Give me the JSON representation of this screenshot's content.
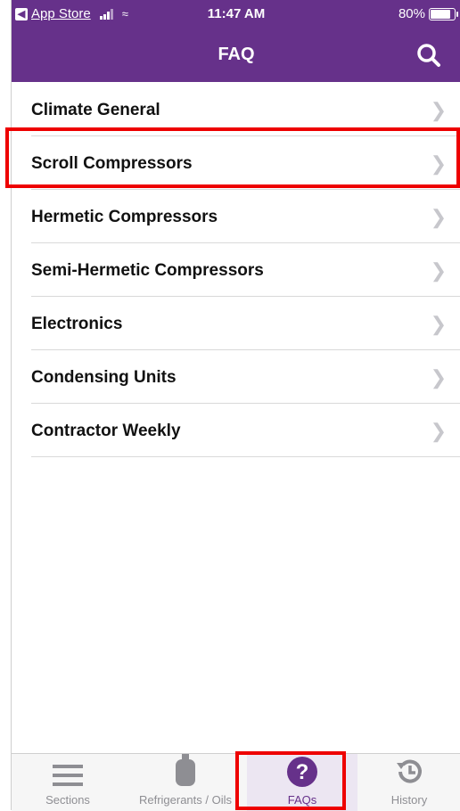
{
  "status_bar": {
    "back_app": "App Store",
    "time": "11:47 AM",
    "battery": "80%",
    "battery_level": 0.8
  },
  "nav": {
    "title": "FAQ",
    "search_icon": "search-icon"
  },
  "list": {
    "items": [
      {
        "label": "Climate General"
      },
      {
        "label": "Scroll Compressors"
      },
      {
        "label": "Hermetic Compressors"
      },
      {
        "label": "Semi-Hermetic Compressors"
      },
      {
        "label": "Electronics"
      },
      {
        "label": "Condensing Units"
      },
      {
        "label": "Contractor Weekly"
      }
    ]
  },
  "tabbar": {
    "tabs": [
      {
        "label": "Sections",
        "icon": "menu-icon"
      },
      {
        "label": "Refrigerants / Oils",
        "icon": "cylinder-icon"
      },
      {
        "label": "FAQs",
        "icon": "question-icon"
      },
      {
        "label": "History",
        "icon": "history-icon"
      }
    ]
  },
  "colors": {
    "brand": "#66318a",
    "highlight": "#ee0000"
  }
}
